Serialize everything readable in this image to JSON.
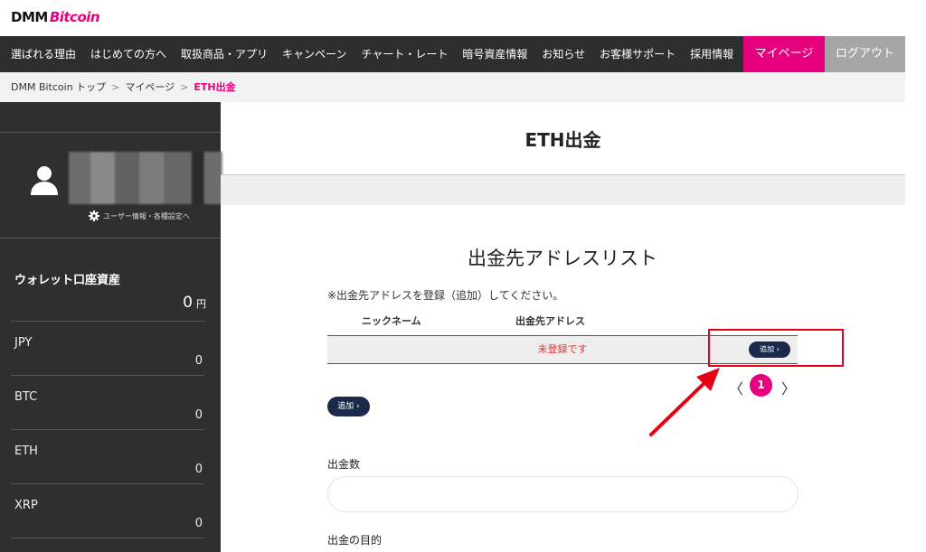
{
  "logo": {
    "dmm": "DMM",
    "bitcoin": "Bitcoin"
  },
  "nav": {
    "items": [
      "選ばれる理由",
      "はじめての方へ",
      "取扱商品・アプリ",
      "キャンペーン",
      "チャート・レート",
      "暗号資産情報",
      "お知らせ",
      "お客様サポート",
      "採用情報"
    ],
    "mypage": "マイページ",
    "logout": "ログアウト"
  },
  "breadcrumb": {
    "home": "DMM Bitcoin トップ",
    "mypage": "マイページ",
    "current": "ETH出金",
    "separator": ">"
  },
  "sidebar": {
    "user_settings": "ユーザー情報・各種設定へ",
    "wallet_title": "ウォレット口座資産",
    "wallet_total": "0",
    "wallet_unit": "円",
    "assets": [
      {
        "label": "JPY",
        "value": "0"
      },
      {
        "label": "BTC",
        "value": "0"
      },
      {
        "label": "ETH",
        "value": "0"
      },
      {
        "label": "XRP",
        "value": "0"
      }
    ]
  },
  "main": {
    "title": "ETH出金",
    "section_title": "出金先アドレスリスト",
    "notice": "※出金先アドレスを登録（追加）してください。",
    "table_headers": {
      "nickname": "ニックネーム",
      "address": "出金先アドレス"
    },
    "empty_text": "未登録です",
    "add_label": "追加",
    "pager": {
      "prev": "〈",
      "current": "1",
      "next": "〉"
    },
    "amount_label": "出金数",
    "amount_value": "",
    "purpose_label": "出金の目的"
  },
  "colors": {
    "brand_pink": "#e6007e",
    "nav_bg": "#2e2e2e",
    "sidebar_bg": "#2f2f2f",
    "button_navy": "#1c2a4a",
    "annotation_red": "#e60012"
  }
}
